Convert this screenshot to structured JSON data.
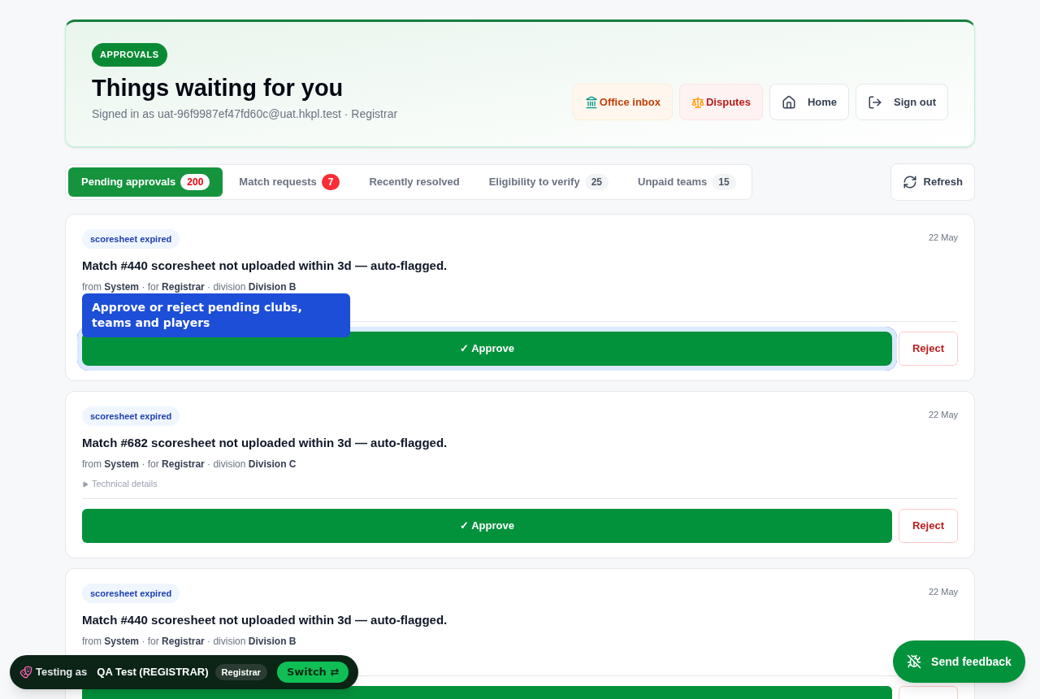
{
  "header": {
    "eyebrow": "APPROVALS",
    "title": "Things waiting for you",
    "subtitle": "Signed in as uat-96f9987ef47fd60c@uat.hkpl.test · Registrar",
    "actions": [
      {
        "kind": "office",
        "label": "Office inbox"
      },
      {
        "kind": "disputes",
        "label": "Disputes"
      },
      {
        "kind": "home",
        "label": "Home"
      },
      {
        "kind": "signout",
        "label": "Sign out"
      }
    ]
  },
  "tabs": [
    {
      "label": "Pending approvals",
      "count": "200",
      "kind": "alert",
      "selected": true
    },
    {
      "label": "Match requests",
      "count": "7",
      "kind": "alert",
      "selected": false
    },
    {
      "label": "Recently resolved",
      "selected": false
    },
    {
      "label": "Eligibility to verify",
      "count": "25",
      "kind": "neutral",
      "selected": false
    },
    {
      "label": "Unpaid teams",
      "count": "15",
      "kind": "neutral",
      "selected": false
    }
  ],
  "refresh": "Refresh",
  "items": [
    {
      "tag": "scoresheet expired",
      "date": "22 May",
      "title": "Match #440 scoresheet not uploaded within 3d — auto-flagged.",
      "from_label": "from",
      "from": "System",
      "for_label": "· for",
      "for": "Registrar",
      "division_label": "· division",
      "division": "Division B",
      "highlighted": true,
      "tooltip": "Approve or reject pending clubs, teams and players",
      "approve": "✓ Approve",
      "reject": "Reject"
    },
    {
      "tag": "scoresheet expired",
      "date": "22 May",
      "title": "Match #682 scoresheet not uploaded within 3d — auto-flagged.",
      "from_label": "from",
      "from": "System",
      "for_label": "· for",
      "for": "Registrar",
      "division_label": "· division",
      "division": "Division C",
      "details": "Technical details",
      "highlighted": false,
      "approve": "✓ Approve",
      "reject": "Reject"
    },
    {
      "tag": "scoresheet expired",
      "date": "22 May",
      "title": "Match #440 scoresheet not uploaded within 3d — auto-flagged.",
      "from_label": "from",
      "from": "System",
      "for_label": "· for",
      "for": "Registrar",
      "division_label": "· division",
      "division": "Division B",
      "highlighted": false
    }
  ],
  "testing_bar": {
    "label": "Testing as",
    "user": "QA Test (REGISTRAR)",
    "role": "Registrar",
    "switch": "Switch ⇄"
  },
  "feedback": "Send feedback"
}
